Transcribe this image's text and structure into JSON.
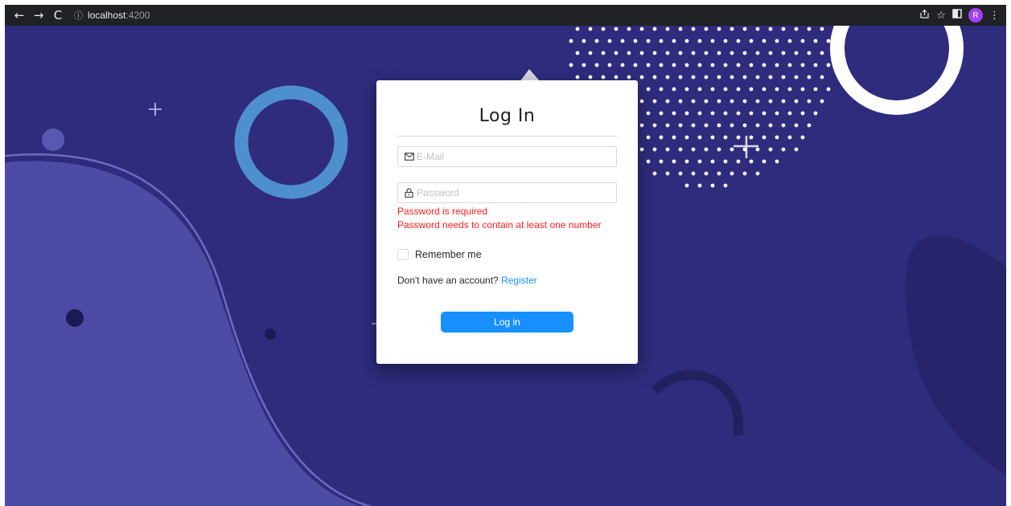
{
  "browser": {
    "back_glyph": "←",
    "forward_glyph": "→",
    "reload_glyph": "C",
    "url_host": "localhost",
    "url_port": ":4200",
    "profile_initial": "R"
  },
  "login": {
    "title": "Log In",
    "email_placeholder": "E-Mail",
    "password_placeholder": "Password",
    "errors": [
      "Password is required",
      "Password needs to contain at least one number"
    ],
    "remember_label": "Remember me",
    "signup_prompt": "Don't have an account?",
    "signup_link": "Register",
    "submit_label": "Log in"
  },
  "colors": {
    "background": "#2f2c7e",
    "accent": "#1890ff",
    "error": "#ff1f1f"
  }
}
